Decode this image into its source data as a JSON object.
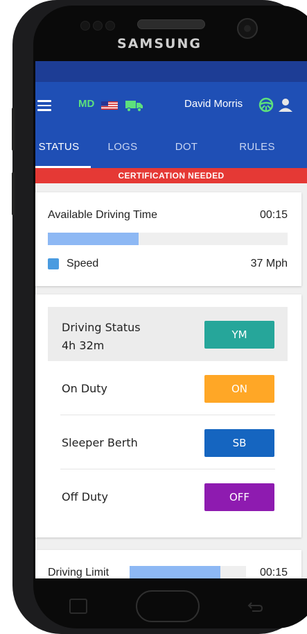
{
  "device": {
    "brand": "SAMSUNG"
  },
  "header": {
    "state_code": "MD",
    "driver_name": "David Morris",
    "icons": [
      "menu-icon",
      "us-flag-icon",
      "truck-icon",
      "steering-wheel-icon",
      "person-icon"
    ]
  },
  "tabs": [
    {
      "label": "STATUS",
      "active": true
    },
    {
      "label": "LOGS",
      "active": false
    },
    {
      "label": "DOT",
      "active": false
    },
    {
      "label": "RULES",
      "active": false
    }
  ],
  "banner": {
    "text": "CERTIFICATION NEEDED",
    "color": "#e53935"
  },
  "driving_time": {
    "label": "Available Driving Time",
    "value": "00:15",
    "progress": 0.38,
    "speed_label": "Speed",
    "speed_value": "37 Mph"
  },
  "statuses": [
    {
      "name": "Driving Status",
      "detail": "4h 32m",
      "code": "YM",
      "color": "#26a69a",
      "selected": true
    },
    {
      "name": "On Duty",
      "code": "ON",
      "color": "#ffa726",
      "selected": false
    },
    {
      "name": "Sleeper Berth",
      "code": "SB",
      "color": "#1565c0",
      "selected": false
    },
    {
      "name": "Off Duty",
      "code": "OFF",
      "color": "#8e1bb0",
      "selected": false
    }
  ],
  "driving_limit": {
    "label": "Driving Limit",
    "value": "00:15",
    "progress": 0.78
  },
  "colors": {
    "primary": "#1f4fb5",
    "status_bar": "#1d3d95",
    "accent_green": "#5de07d",
    "progress": "#8db8f4"
  }
}
